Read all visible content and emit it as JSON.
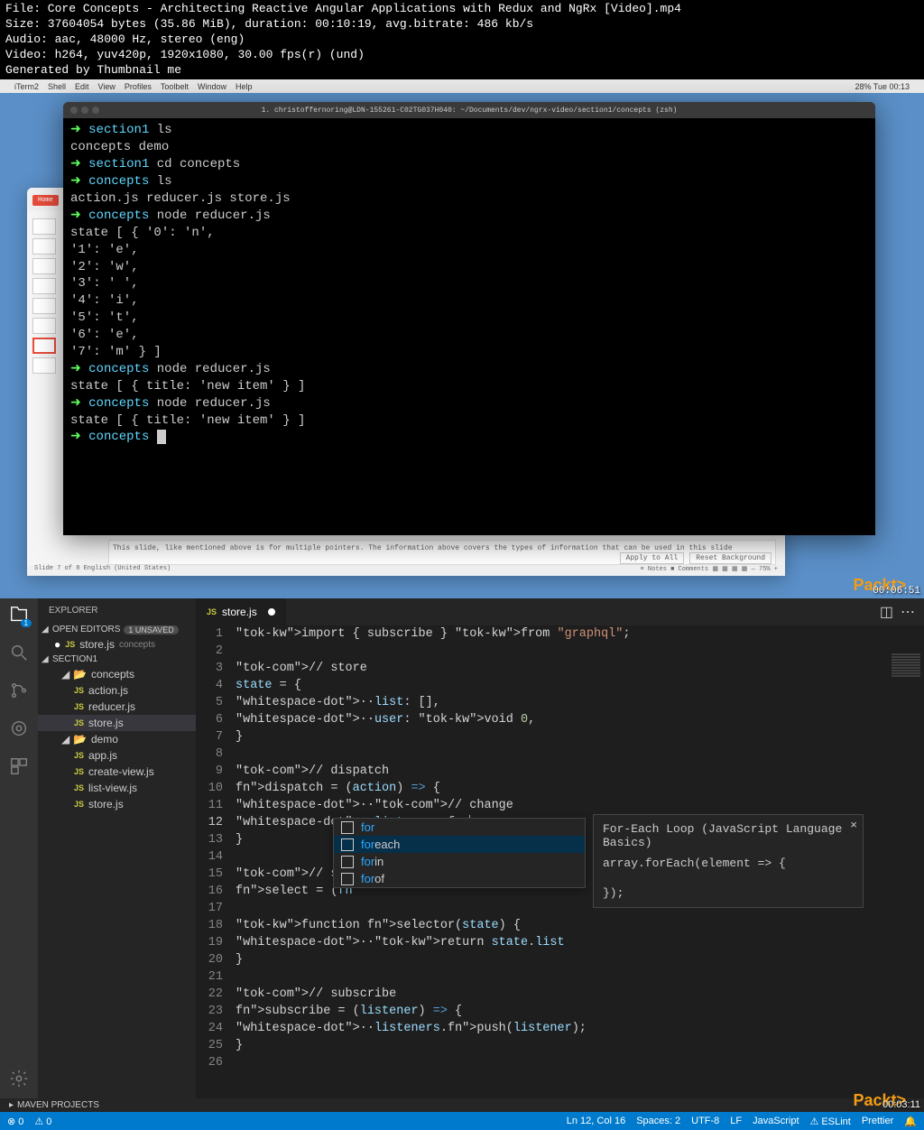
{
  "video_info": {
    "file": "File: Core Concepts - Architecting Reactive Angular Applications with Redux and NgRx [Video].mp4",
    "size": "Size: 37604054 bytes (35.86 MiB), duration: 00:10:19, avg.bitrate: 486 kb/s",
    "audio": "Audio: aac, 48000 Hz, stereo (eng)",
    "video": "Video: h264, yuv420p, 1920x1080, 30.00 fps(r) (und)",
    "generated": "Generated by Thumbnail me"
  },
  "mac_menu": {
    "app": "iTerm2",
    "items": [
      "Shell",
      "Edit",
      "View",
      "Profiles",
      "Toolbelt",
      "Window",
      "Help"
    ],
    "right": "28%  Tue 00:13"
  },
  "terminal": {
    "title": "1. christoffernoring@LDN-155261-C02TG037H040: ~/Documents/dev/ngrx-video/section1/concepts (zsh)",
    "lines": [
      {
        "type": "prompt",
        "dir": "section1",
        "cmd": "ls"
      },
      {
        "type": "out",
        "text": "concepts demo"
      },
      {
        "type": "prompt",
        "dir": "section1",
        "cmd": "cd concepts"
      },
      {
        "type": "prompt",
        "dir": "concepts",
        "cmd": "ls"
      },
      {
        "type": "out",
        "text": "action.js  reducer.js store.js"
      },
      {
        "type": "prompt",
        "dir": "concepts",
        "cmd": "node reducer.js"
      },
      {
        "type": "out",
        "text": "state [ { '0': 'n',"
      },
      {
        "type": "out",
        "text": "    '1': 'e',"
      },
      {
        "type": "out",
        "text": "    '2': 'w',"
      },
      {
        "type": "out",
        "text": "    '3': ' ',"
      },
      {
        "type": "out",
        "text": "    '4': 'i',"
      },
      {
        "type": "out",
        "text": "    '5': 't',"
      },
      {
        "type": "out",
        "text": "    '6': 'e',"
      },
      {
        "type": "out",
        "text": "    '7': 'm' } ]"
      },
      {
        "type": "prompt",
        "dir": "concepts",
        "cmd": "node reducer.js"
      },
      {
        "type": "out",
        "text": "state [ { title: 'new item' } ]"
      },
      {
        "type": "prompt",
        "dir": "concepts",
        "cmd": "node reducer.js"
      },
      {
        "type": "out",
        "text": "state [ { title: 'new item' } ]"
      },
      {
        "type": "prompt",
        "dir": "concepts",
        "cmd": "",
        "cursor": true
      }
    ]
  },
  "ppt": {
    "slide_text": "This slide, like mentioned above is for multiple pointers. The information above covers the types of information that can be used in this slide",
    "status_left": "Slide 7 of 8    English (United States)",
    "apply": "Apply to All",
    "reset": "Reset Background",
    "home": "Home"
  },
  "timestamps": {
    "top": "00:06:51",
    "bottom": "00:03:11"
  },
  "packt": "Packt>",
  "vscode": {
    "explorer": {
      "title": "EXPLORER",
      "open_editors": "OPEN EDITORS",
      "unsaved": "1 UNSAVED",
      "open_file": "store.js",
      "open_file_path": "concepts",
      "section": "SECTION1",
      "folders": {
        "concepts": {
          "name": "concepts",
          "files": [
            "action.js",
            "reducer.js",
            "store.js"
          ]
        },
        "demo": {
          "name": "demo",
          "files": [
            "app.js",
            "create-view.js",
            "list-view.js",
            "store.js"
          ]
        }
      },
      "maven": "MAVEN PROJECTS"
    },
    "tab": {
      "name": "store.js"
    },
    "code_lines": [
      "import { subscribe } from \"graphql\";",
      "",
      "// store",
      "state = {",
      "  list: [],",
      "  user: void 0,",
      "}",
      "",
      "// dispatch",
      "dispatch = (action) => {",
      "  // change",
      "  listeners.for",
      "}",
      "",
      "// select",
      "select = (fn",
      "",
      "function selector(state) {",
      "  return state.list",
      "}",
      "",
      "// subscribe",
      "subscribe = (listener) => {",
      "  listeners.push(listener);",
      "}",
      ""
    ],
    "autocomplete": {
      "items": [
        {
          "prefix": "for",
          "suffix": ""
        },
        {
          "prefix": "for",
          "suffix": "each"
        },
        {
          "prefix": "for",
          "suffix": "in"
        },
        {
          "prefix": "for",
          "suffix": "of"
        }
      ],
      "selected": 1
    },
    "doc": {
      "title": "For-Each Loop (JavaScript Language Basics)",
      "body1": "array.forEach(element => {",
      "body2": "});"
    },
    "status": {
      "errors": "⊗ 0",
      "warnings": "⚠ 0",
      "pos": "Ln 12, Col 16",
      "spaces": "Spaces: 2",
      "encoding": "UTF-8",
      "eol": "LF",
      "lang": "JavaScript",
      "eslint": "⚠ ESLint",
      "prettier": "Prettier",
      "bell": "🔔"
    }
  }
}
